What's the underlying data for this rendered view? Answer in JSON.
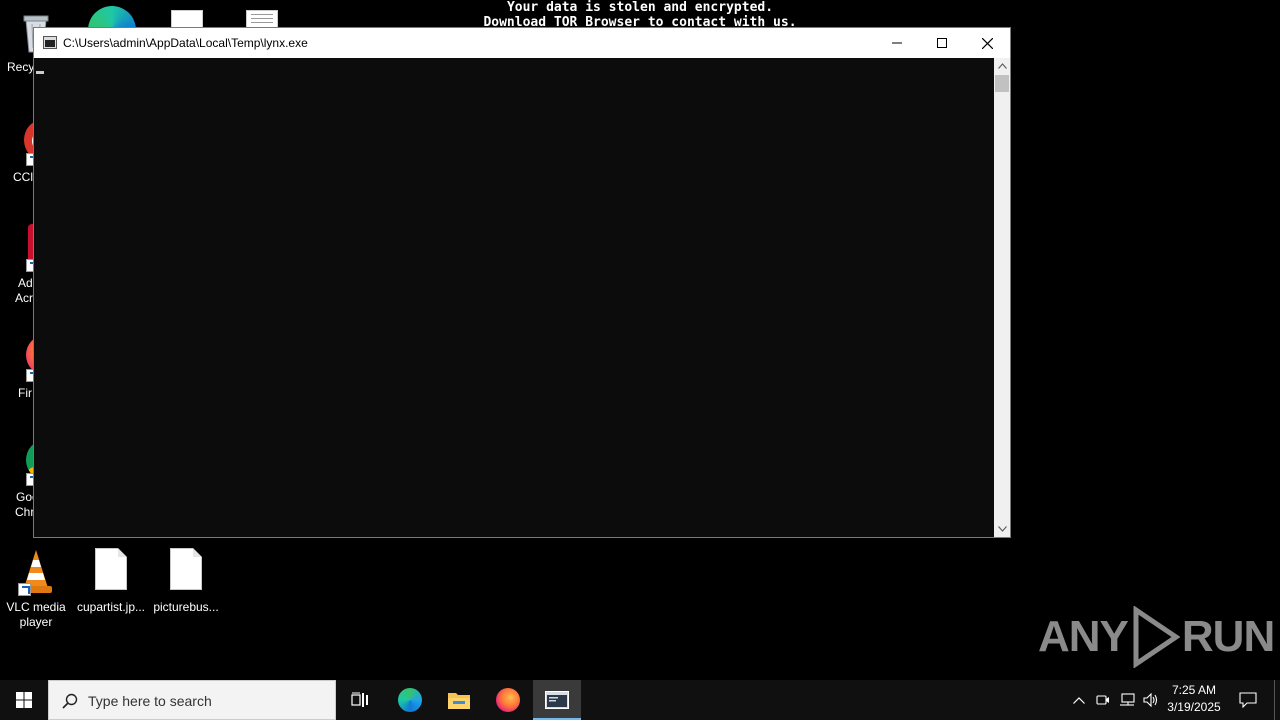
{
  "banner": {
    "line1": "Your data is stolen and encrypted.",
    "line2": "Download TOR Browser to contact with us."
  },
  "desktop_icons": [
    {
      "name": "recycle-bin",
      "label": "Recy"
    },
    {
      "name": "ccleaner",
      "label": "CCl"
    },
    {
      "name": "adobe-acrobat",
      "label_line1": "Ad",
      "label_line2": "Acr"
    },
    {
      "name": "firefox",
      "label": "Fir"
    },
    {
      "name": "google-chrome",
      "label_line1": "Goo",
      "label_line2": "Chr"
    },
    {
      "name": "vlc",
      "label_line1": "VLC media",
      "label_line2": "player"
    },
    {
      "name": "cupartist",
      "label": "cupartist.jp..."
    },
    {
      "name": "picturebus",
      "label": "picturebus..."
    }
  ],
  "window": {
    "title": "C:\\Users\\admin\\AppData\\Local\\Temp\\lynx.exe",
    "minimize_icon": "minimize-icon",
    "maximize_icon": "maximize-icon",
    "close_icon": "close-icon"
  },
  "watermark": {
    "text_left": "ANY",
    "text_right": "RUN"
  },
  "taskbar": {
    "search_placeholder": "Type here to search",
    "pinned": [
      "start-icon",
      "task-view-icon",
      "edge-icon",
      "file-explorer-icon",
      "firefox-icon",
      "console-app-icon"
    ],
    "tray_icons": [
      "chevron-up-icon",
      "meet-now-icon",
      "network-icon",
      "volume-icon"
    ],
    "time": "7:25 AM",
    "date": "3/19/2025",
    "notification_icon": "notification-icon"
  }
}
